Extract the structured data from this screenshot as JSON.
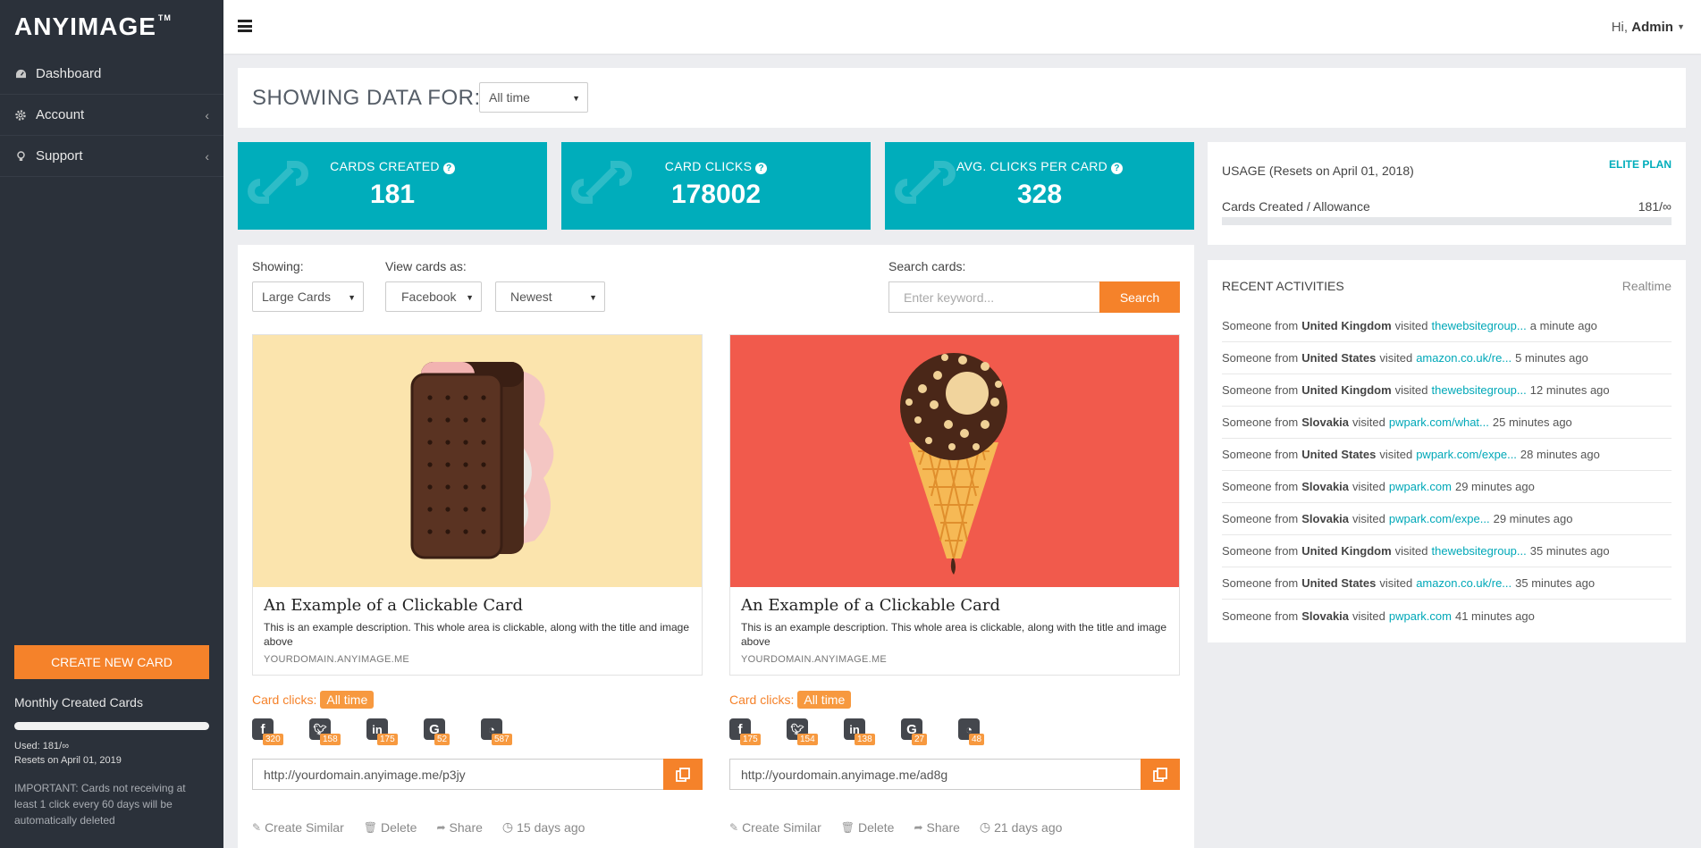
{
  "brand": {
    "logo_text": "ANYIMAGE",
    "logo_tm": "TM"
  },
  "sidebar": {
    "items": [
      {
        "label": "Dashboard",
        "icon": "dashboard-icon"
      },
      {
        "label": "Account",
        "icon": "gear-icon"
      },
      {
        "label": "Support",
        "icon": "lightbulb-icon"
      }
    ],
    "create_label": "CREATE NEW CARD",
    "monthly_label": "Monthly Created Cards",
    "used_text": "Used: 181/∞",
    "resets_text": "Resets on April 01, 2019",
    "important_text": "IMPORTANT: Cards not receiving at least 1 click every 60 days will be automatically deleted"
  },
  "topbar": {
    "greeting": "Hi,",
    "user": "Admin"
  },
  "showing": {
    "title": "SHOWING DATA FOR:",
    "selected": "All time"
  },
  "stats": [
    {
      "title": "CARDS CREATED",
      "value": "181"
    },
    {
      "title": "CARD CLICKS",
      "value": "178002"
    },
    {
      "title": "AVG. CLICKS PER CARD",
      "value": "328"
    }
  ],
  "usage": {
    "title": "USAGE (Resets on April 01, 2018)",
    "plan": "ELITE PLAN",
    "row_label": "Cards Created / Allowance",
    "row_value": "181/∞"
  },
  "recent": {
    "title": "RECENT ACTIVITIES",
    "realtime": "Realtime",
    "items": [
      {
        "prefix": "Someone from",
        "country": "United Kingdom",
        "verb": "visited",
        "link": "thewebsitegroup...",
        "time": "a minute ago"
      },
      {
        "prefix": "Someone from",
        "country": "United States",
        "verb": "visited",
        "link": "amazon.co.uk/re...",
        "time": "5 minutes ago"
      },
      {
        "prefix": "Someone from",
        "country": "United Kingdom",
        "verb": "visited",
        "link": "thewebsitegroup...",
        "time": "12 minutes ago"
      },
      {
        "prefix": "Someone from",
        "country": "Slovakia",
        "verb": "visited",
        "link": "pwpark.com/what...",
        "time": "25 minutes ago"
      },
      {
        "prefix": "Someone from",
        "country": "United States",
        "verb": "visited",
        "link": "pwpark.com/expe...",
        "time": "28 minutes ago"
      },
      {
        "prefix": "Someone from",
        "country": "Slovakia",
        "verb": "visited",
        "link": "pwpark.com",
        "time": "29 minutes ago"
      },
      {
        "prefix": "Someone from",
        "country": "Slovakia",
        "verb": "visited",
        "link": "pwpark.com/expe...",
        "time": "29 minutes ago"
      },
      {
        "prefix": "Someone from",
        "country": "United Kingdom",
        "verb": "visited",
        "link": "thewebsitegroup...",
        "time": "35 minutes ago"
      },
      {
        "prefix": "Someone from",
        "country": "United States",
        "verb": "visited",
        "link": "amazon.co.uk/re...",
        "time": "35 minutes ago"
      },
      {
        "prefix": "Someone from",
        "country": "Slovakia",
        "verb": "visited",
        "link": "pwpark.com",
        "time": "41 minutes ago"
      }
    ]
  },
  "filters": {
    "showing_label": "Showing:",
    "showing_value": "Large Cards",
    "view_label": "View cards as:",
    "view_value": "Facebook",
    "sort_value": "Newest",
    "search_label": "Search cards:",
    "search_placeholder": "Enter keyword...",
    "search_button": "Search"
  },
  "cards": [
    {
      "title": "An Example of a Clickable Card",
      "description": "This is an example description. This whole area is clickable, along with the title and image above",
      "domain": "YOURDOMAIN.ANYIMAGE.ME",
      "bg_color": "#fbe4ad",
      "clicks_label": "Card clicks:",
      "clicks_range": "All time",
      "social": {
        "facebook": "320",
        "twitter": "158",
        "linkedin": "175",
        "google": "52",
        "other": "587"
      },
      "url": "http://yourdomain.anyimage.me/p3jy",
      "create_similar": "Create Similar",
      "delete": "Delete",
      "share": "Share",
      "age": "15 days ago"
    },
    {
      "title": "An Example of a Clickable Card",
      "description": "This is an example description. This whole area is clickable, along with the title and image above",
      "domain": "YOURDOMAIN.ANYIMAGE.ME",
      "bg_color": "#f15a4c",
      "clicks_label": "Card clicks:",
      "clicks_range": "All time",
      "social": {
        "facebook": "175",
        "twitter": "154",
        "linkedin": "138",
        "google": "27",
        "other": "48"
      },
      "url": "http://yourdomain.anyimage.me/ad8g",
      "create_similar": "Create Similar",
      "delete": "Delete",
      "share": "Share",
      "age": "21 days ago"
    }
  ],
  "colors": {
    "accent_teal": "#00adbb",
    "accent_orange": "#f5822a",
    "sidebar_bg": "#2b313a"
  }
}
